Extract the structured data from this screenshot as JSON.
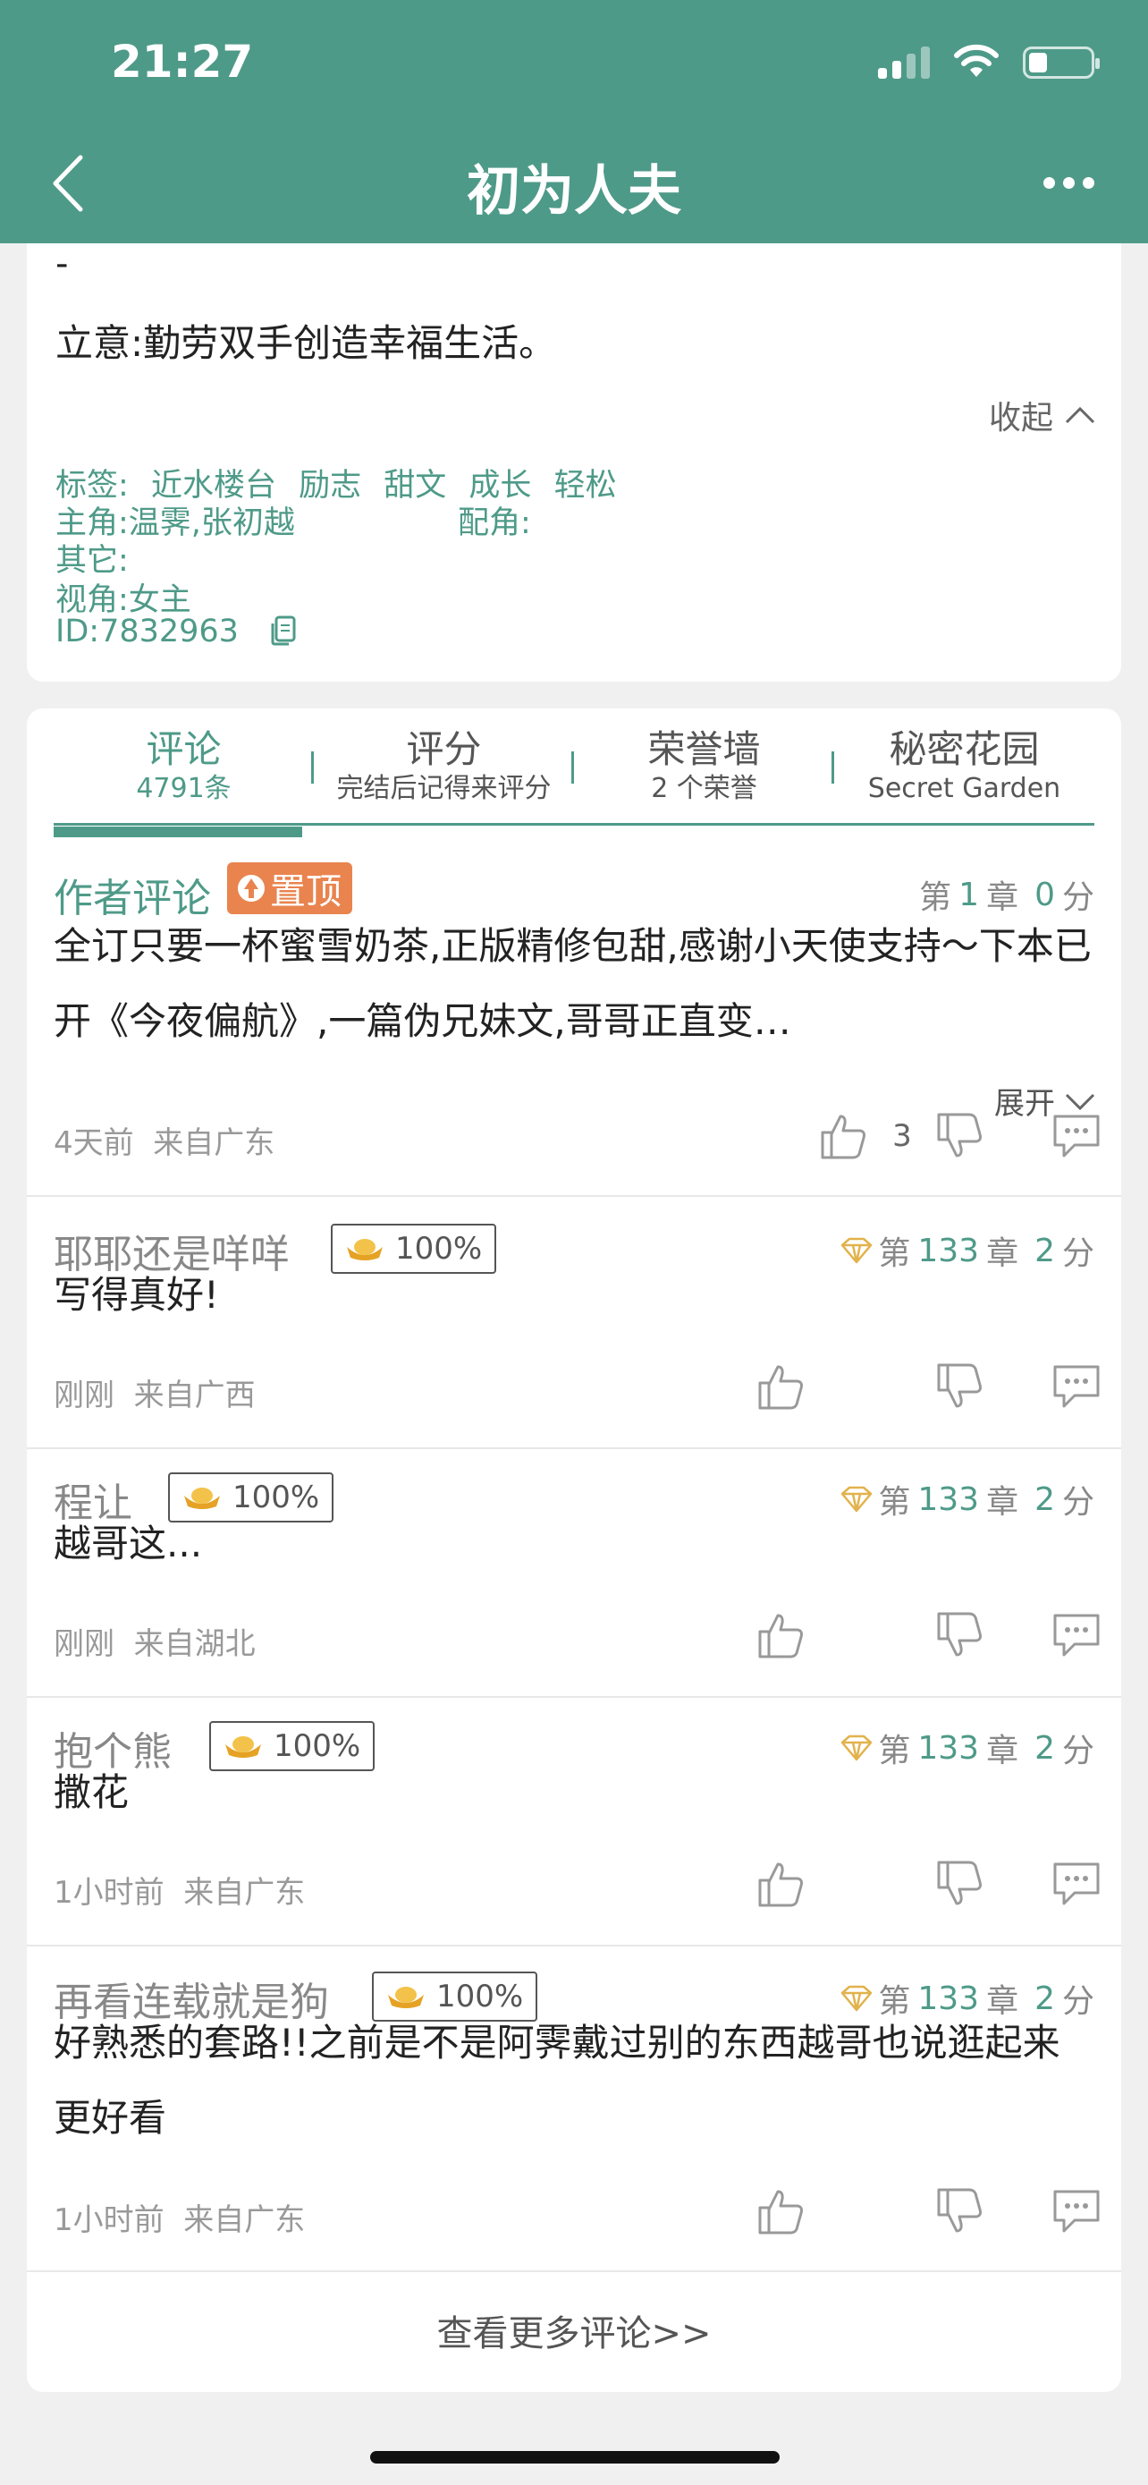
{
  "status": {
    "time": "21:27"
  },
  "nav": {
    "title": "初为人夫"
  },
  "info": {
    "dash": "-",
    "intent": "立意:勤劳双手创造幸福生活。",
    "collapse": "收起",
    "tags_label": "标签:",
    "tags": [
      "近水楼台",
      "励志",
      "甜文",
      "成长",
      "轻松"
    ],
    "protagonists": "主角:温霁,张初越",
    "supporting": "配角:",
    "other": "其它:",
    "perspective": "视角:女主",
    "id": "ID:7832963"
  },
  "tabs": [
    {
      "label": "评论",
      "sub": "4791条",
      "active": true
    },
    {
      "label": "评分",
      "sub": "完结后记得来评分",
      "active": false
    },
    {
      "label": "荣誉墙",
      "sub": "2 个荣誉",
      "active": false
    },
    {
      "label": "秘密花园",
      "sub": "Secret Garden",
      "active": false
    }
  ],
  "comments": [
    {
      "name": "作者评论",
      "pin": "置顶",
      "chapter_prefix": "第",
      "chapter": "1",
      "chapter_suffix": "章",
      "score": "0",
      "score_suffix": "分",
      "body": "全订只要一杯蜜雪奶茶,正版精修包甜,感谢小天使支持～下本已开《今夜偏航》,一篇伪兄妹文,哥哥正直变…",
      "expand": "展开",
      "time": "4天前",
      "location": "来自广东",
      "likes": "3"
    },
    {
      "name": "耶耶还是咩咩",
      "badge": "100%",
      "chapter_prefix": "第",
      "chapter": "133",
      "chapter_suffix": "章",
      "score": "2",
      "score_suffix": "分",
      "body": "写得真好!",
      "time": "刚刚",
      "location": "来自广西"
    },
    {
      "name": "程让",
      "badge": "100%",
      "chapter_prefix": "第",
      "chapter": "133",
      "chapter_suffix": "章",
      "score": "2",
      "score_suffix": "分",
      "body": "越哥这...",
      "time": "刚刚",
      "location": "来自湖北"
    },
    {
      "name": "抱个熊",
      "badge": "100%",
      "chapter_prefix": "第",
      "chapter": "133",
      "chapter_suffix": "章",
      "score": "2",
      "score_suffix": "分",
      "body": "撒花",
      "time": "1小时前",
      "location": "来自广东"
    },
    {
      "name": "再看连载就是狗",
      "badge": "100%",
      "chapter_prefix": "第",
      "chapter": "133",
      "chapter_suffix": "章",
      "score": "2",
      "score_suffix": "分",
      "body": "好熟悉的套路!!之前是不是阿霁戴过别的东西越哥也说逛起来更好看",
      "time": "1小时前",
      "location": "来自广东"
    }
  ],
  "more_comments": "查看更多评论>>"
}
